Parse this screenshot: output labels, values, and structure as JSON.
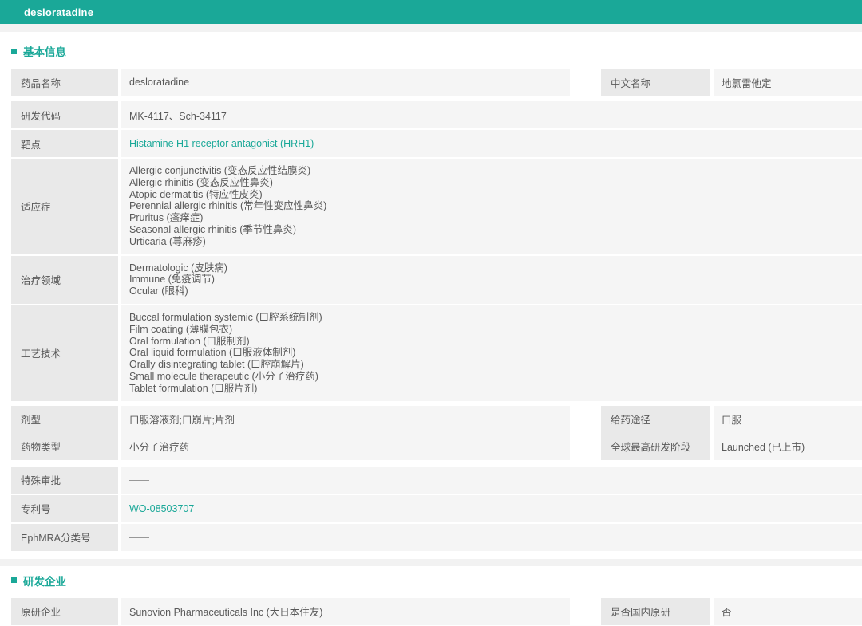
{
  "header": {
    "title": "desloratadine"
  },
  "colors": {
    "accent": "#1aa898",
    "label_bg": "#e9e9e9",
    "value_bg": "#f5f5f5",
    "band_bg": "#f2f2f2",
    "text": "#595959"
  },
  "sections": {
    "basic_info": {
      "title": "基本信息"
    },
    "rd_companies": {
      "title": "研发企业"
    }
  },
  "fields": {
    "drug_name": {
      "label": "药品名称",
      "value": "desloratadine"
    },
    "chinese_name": {
      "label": "中文名称",
      "value": "地氯雷他定"
    },
    "rd_code": {
      "label": "研发代码",
      "value": "MK-4117、Sch-34117"
    },
    "target": {
      "label": "靶点",
      "value": "Histamine H1 receptor antagonist (HRH1)"
    },
    "indications": {
      "label": "适应症",
      "value": [
        "Allergic conjunctivitis (变态反应性结膜炎)",
        "Allergic rhinitis (变态反应性鼻炎)",
        "Atopic dermatitis (特应性皮炎)",
        "Perennial allergic rhinitis (常年性变应性鼻炎)",
        "Pruritus (瘙痒症)",
        "Seasonal allergic rhinitis (季节性鼻炎)",
        "Urticaria (荨麻疹)"
      ]
    },
    "therapeutic_areas": {
      "label": "治疗领域",
      "value": [
        "Dermatologic (皮肤病)",
        "Immune (免疫调节)",
        "Ocular (眼科)"
      ]
    },
    "technologies": {
      "label": "工艺技术",
      "value": [
        "Buccal formulation systemic (口腔系统制剂)",
        "Film coating (薄膜包衣)",
        "Oral formulation (口服制剂)",
        "Oral liquid formulation (口服液体制剂)",
        "Orally disintegrating tablet (口腔崩解片)",
        "Small molecule therapeutic (小分子治疗药)",
        "Tablet formulation (口服片剂)"
      ]
    },
    "dosage_form": {
      "label": "剂型",
      "value": "口服溶液剂;口崩片;片剂"
    },
    "route": {
      "label": "给药途径",
      "value": "口服"
    },
    "drug_type": {
      "label": "药物类型",
      "value": "小分子治疗药"
    },
    "global_highest_phase": {
      "label": "全球最高研发阶段",
      "value": "Launched (已上市)"
    },
    "special_approval": {
      "label": "特殊审批",
      "value": "——"
    },
    "patent_no": {
      "label": "专利号",
      "value": "WO-08503707"
    },
    "ephmra_code": {
      "label": "EphMRA分类号",
      "value": "——"
    },
    "originator": {
      "label": "原研企业",
      "value": "Sunovion Pharmaceuticals Inc (大日本住友)"
    },
    "domestic_originator": {
      "label": "是否国内原研",
      "value": "否"
    }
  }
}
